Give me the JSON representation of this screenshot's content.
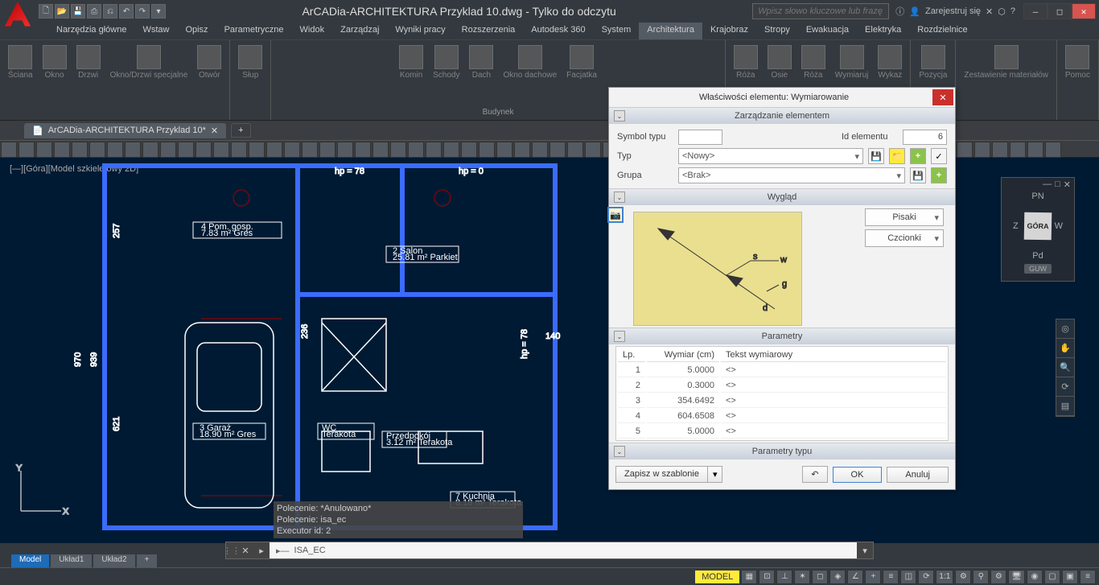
{
  "app": {
    "title": "ArCADia-ARCHITEKTURA Przyklad 10.dwg - Tylko do odczytu",
    "search_placeholder": "Wpisz słowo kluczowe lub frazę",
    "signin": "Zarejestruj się"
  },
  "menu": {
    "tabs": [
      "Narzędzia główne",
      "Wstaw",
      "Opisz",
      "Parametryczne",
      "Widok",
      "Zarządzaj",
      "Wyniki pracy",
      "Rozszerzenia",
      "Autodesk 360",
      "System",
      "Architektura",
      "Krajobraz",
      "Stropy",
      "Ewakuacja",
      "Elektryka",
      "Rozdzielnice"
    ],
    "active": "Architektura"
  },
  "ribbon": {
    "panels": [
      {
        "title": "",
        "buttons": [
          "Ściana",
          "Okno",
          "Drzwi",
          "Okno/Drzwi specjalne",
          "Otwór"
        ]
      },
      {
        "title": "",
        "buttons": [
          "Słup",
          "—",
          "—"
        ]
      },
      {
        "title": "Budynek",
        "buttons": [
          "Komin",
          "Schody",
          "Dach",
          "Okno dachowe",
          "Facjatka"
        ]
      },
      {
        "title": "",
        "buttons": [
          "Róża",
          "Osie",
          "Róża",
          "Wymiaruj",
          "Wykaz"
        ]
      },
      {
        "title": "",
        "buttons": [
          "Pozycja"
        ]
      },
      {
        "title": "",
        "buttons": [
          "Zestawienie materiałów"
        ]
      },
      {
        "title": "",
        "buttons": [
          "Pomoc"
        ]
      }
    ]
  },
  "doc_tabs": {
    "tabs": [
      "ArCADia-ARCHITEKTURA Przyklad 10*"
    ]
  },
  "viewport": {
    "label": "[—][Góra][Model szkieletowy 2D]"
  },
  "viewcube": {
    "face": "GÓRA",
    "n": "PN",
    "s": "Pd",
    "w": "Z",
    "e": "W",
    "btn": "GUW"
  },
  "cmd_output": [
    "Polecenie: *Anulowano*",
    "Polecenie: isa_ec",
    "Executor id: 2"
  ],
  "cmdline": {
    "prompt": "▸—",
    "value": "ISA_EC"
  },
  "view_tabs": {
    "tabs": [
      "Model",
      "Układ1",
      "Układ2"
    ],
    "active": "Model"
  },
  "status": {
    "model": "MODEL",
    "scale": "1:1"
  },
  "dialog": {
    "title": "Właściwości elementu: Wymiarowanie",
    "sections": {
      "manage": {
        "title": "Zarządzanie elementem",
        "symbol_type_lbl": "Symbol typu",
        "symbol_type": "",
        "id_lbl": "Id elementu",
        "id": "6",
        "typ_lbl": "Typ",
        "typ": "<Nowy>",
        "grupa_lbl": "Grupa",
        "grupa": "<Brak>"
      },
      "appearance": {
        "title": "Wygląd",
        "pisaki": "Pisaki",
        "czcionki": "Czcionki"
      },
      "params": {
        "title": "Parametry",
        "headers": [
          "Lp.",
          "Wymiar (cm)",
          "Tekst wymiarowy"
        ],
        "rows": [
          {
            "lp": "1",
            "dim": "5.0000",
            "txt": "<>"
          },
          {
            "lp": "2",
            "dim": "0.3000",
            "txt": "<>"
          },
          {
            "lp": "3",
            "dim": "354.6492",
            "txt": "<>"
          },
          {
            "lp": "4",
            "dim": "604.6508",
            "txt": "<>"
          },
          {
            "lp": "5",
            "dim": "5.0000",
            "txt": "<>"
          }
        ]
      },
      "type_params": {
        "title": "Parametry typu"
      }
    },
    "buttons": {
      "save": "Zapisz w szablonie",
      "undo": "↶",
      "ok": "OK",
      "cancel": "Anuluj"
    }
  }
}
